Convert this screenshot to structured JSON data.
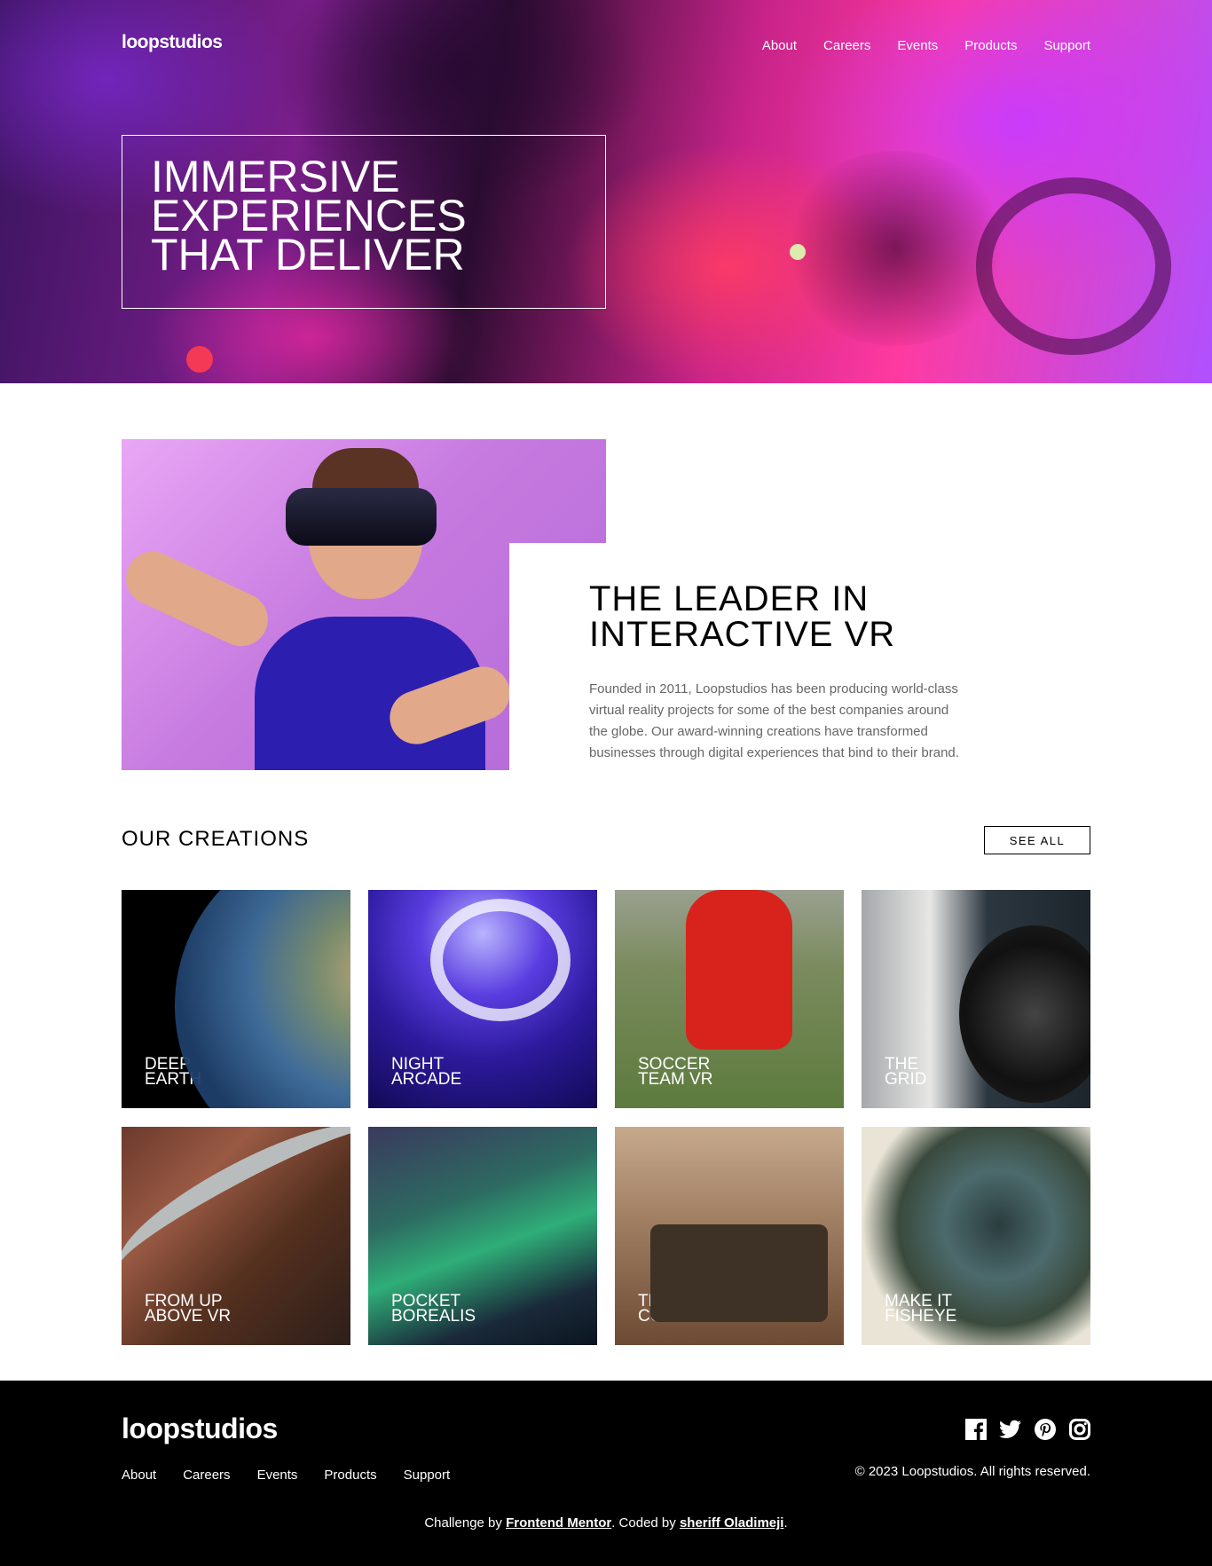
{
  "header": {
    "logo": "loopstudios",
    "nav": [
      "About",
      "Careers",
      "Events",
      "Products",
      "Support"
    ]
  },
  "hero": {
    "headline": "IMMERSIVE\nEXPERIENCES\nTHAT DELIVER"
  },
  "intro": {
    "title": "THE LEADER IN\nINTERACTIVE VR",
    "body": "Founded in 2011, Loopstudios has been producing world-class virtual reality projects for some of the best companies around the globe. Our award-winning creations have transformed businesses through digital experiences that bind to their brand."
  },
  "creations": {
    "title": "OUR CREATIONS",
    "see_all": "SEE ALL",
    "items": [
      {
        "label": "DEEP\nEARTH"
      },
      {
        "label": "NIGHT\nARCADE"
      },
      {
        "label": "SOCCER\nTEAM VR"
      },
      {
        "label": "THE\nGRID"
      },
      {
        "label": "FROM UP\nABOVE VR"
      },
      {
        "label": "POCKET\nBOREALIS"
      },
      {
        "label": "THE\nCURIOSITY"
      },
      {
        "label": "MAKE IT\nFISHEYE"
      }
    ]
  },
  "footer": {
    "logo": "loopstudios",
    "nav": [
      "About",
      "Careers",
      "Events",
      "Products",
      "Support"
    ],
    "socials": [
      "facebook-icon",
      "twitter-icon",
      "pinterest-icon",
      "instagram-icon"
    ],
    "copyright": "© 2023 Loopstudios. All rights reserved.",
    "attribution": {
      "prefix": "Challenge by ",
      "link1": "Frontend Mentor",
      "middle": ". Coded by ",
      "link2": "sheriff Oladimeji",
      "suffix": "."
    }
  }
}
